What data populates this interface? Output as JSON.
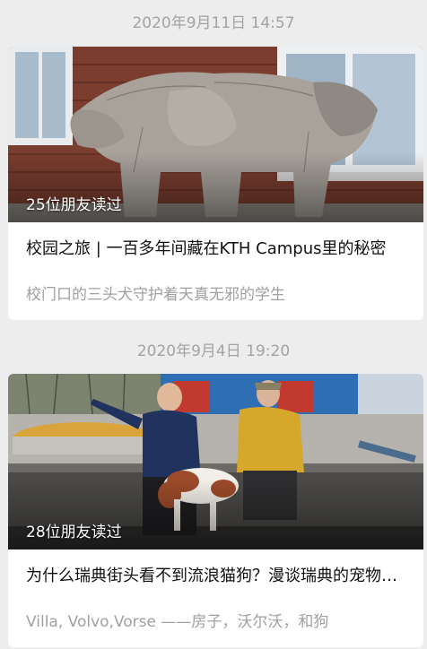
{
  "articles": [
    {
      "timestamp": "2020年9月11日 14:57",
      "readers": "25位朋友读过",
      "title": "校园之旅 | 一百多年间藏在KTH Campus里的秘密",
      "summary": "校门口的三头犬守护着天真无邪的学生",
      "image_description": "stone-three-headed-dog-statue"
    },
    {
      "timestamp": "2020年9月4日 19:20",
      "readers": "28位朋友读过",
      "title": "为什么瑞典街头看不到流浪猫狗？漫谈瑞典的宠物文化",
      "summary": "Villa, Volvo,Vorse ——房子，沃尔沃，和狗",
      "image_description": "elderly-couple-with-dog-on-bench"
    }
  ],
  "colors": {
    "background": "#ededed",
    "card": "#ffffff",
    "timestamp_text": "#a3a3a3",
    "title_text": "#111111",
    "summary_text": "#a0a0a0"
  }
}
